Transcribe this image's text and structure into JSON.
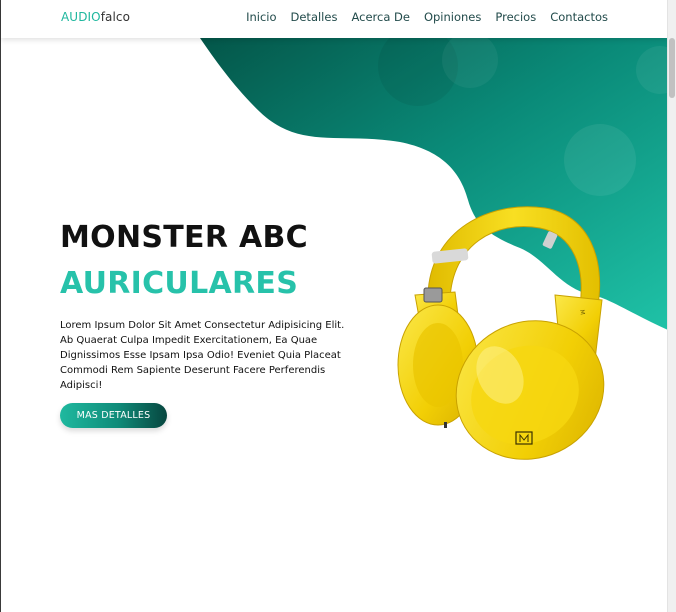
{
  "header": {
    "logo_primary": "AUDIO",
    "logo_secondary": "falco",
    "nav": [
      {
        "label": "Inicio"
      },
      {
        "label": "Detalles"
      },
      {
        "label": "Acerca De"
      },
      {
        "label": "Opiniones"
      },
      {
        "label": "Precios"
      },
      {
        "label": "Contactos"
      }
    ]
  },
  "hero": {
    "title": "MONSTER ABC",
    "subtitle": "AURICULARES",
    "description": "Lorem Ipsum Dolor Sit Amet Consectetur Adipisicing Elit. Ab Quaerat Culpa Impedit Exercitationem, Ea Quae Dignissimos Esse Ipsam Ipsa Odio! Eveniet Quia Placeat Commodi Rem Sapiente Deserunt Facere Perferendis Adipisci!",
    "cta_label": "MAS DETALLES"
  },
  "colors": {
    "accent": "#27c2aa",
    "dark_teal": "#06594f",
    "product_yellow": "#f5d90a"
  },
  "icons": {
    "product_image": "yellow-headphones"
  }
}
